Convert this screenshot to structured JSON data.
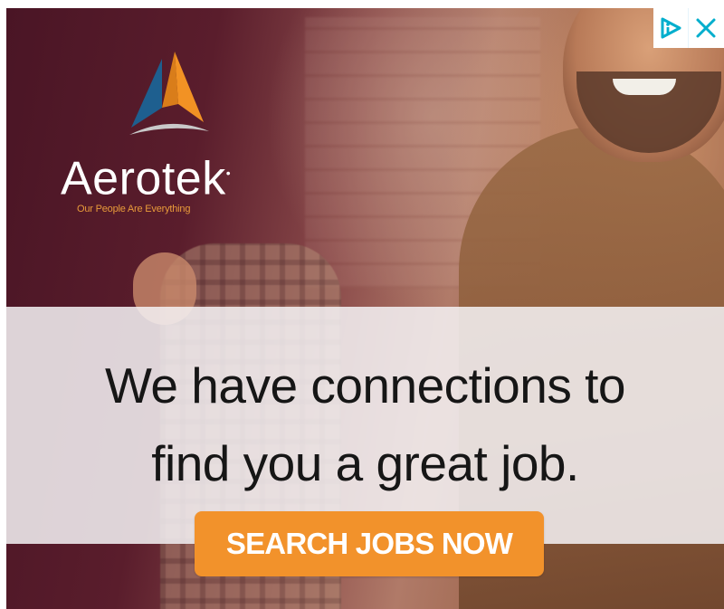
{
  "ad": {
    "brand": "Aerotek",
    "tagline": "Our People Are Everything",
    "headline_line1": "We have connections to",
    "headline_line2": "find you a great job.",
    "cta_label": "SEARCH JOBS NOW"
  },
  "controls": {
    "adchoices_icon": "ad-choices-icon",
    "close_icon": "close-icon"
  },
  "colors": {
    "cta": "#f2922b",
    "tagline": "#e89a3a",
    "logo_blue": "#1e5f8f",
    "logo_orange": "#f29224",
    "adicon_blue": "#00aecd"
  }
}
